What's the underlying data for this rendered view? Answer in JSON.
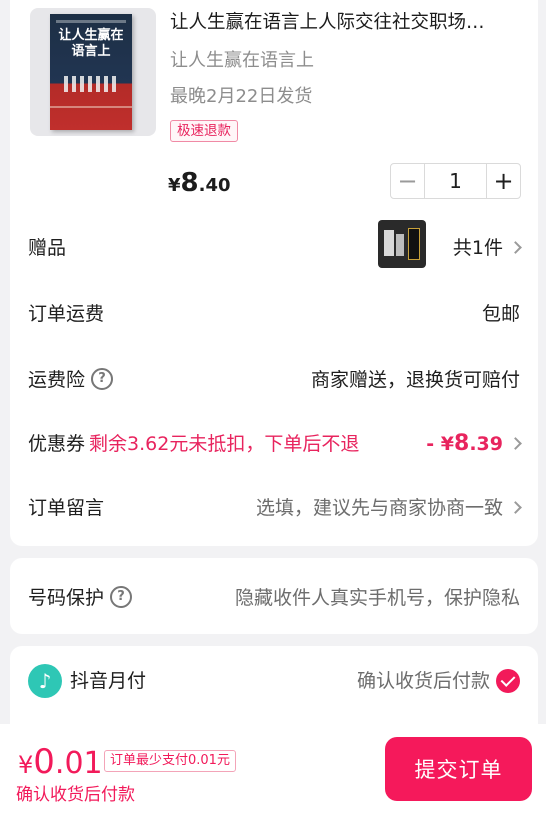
{
  "product": {
    "book_cover_title": "让人生赢在语言上",
    "title": "让人生赢在语言上人际交往社交职场…",
    "subtitle": "让人生赢在语言上",
    "shipping_note": "最晚2月22日发货",
    "tag": "极速退款",
    "price_currency": "¥",
    "price_integer": "8",
    "price_decimal": ".40",
    "quantity": "1",
    "minus_symbol": "−",
    "plus_symbol": "+"
  },
  "rows": {
    "gift": {
      "label": "赠品",
      "value": "共1件"
    },
    "shipping_fee": {
      "label": "订单运费",
      "value": "包邮"
    },
    "shipping_insurance": {
      "label": "运费险",
      "help": "?",
      "value": "商家赠送，退换货可赔付"
    },
    "coupon": {
      "label": "优惠券",
      "note": "剩余3.62元未抵扣，下单后不退",
      "discount_prefix": "- ¥",
      "discount_integer": "8",
      "discount_decimal": ".39"
    },
    "remark": {
      "label": "订单留言",
      "placeholder": "选填，建议先与商家协商一致"
    }
  },
  "privacy": {
    "label": "号码保护",
    "help": "?",
    "value": "隐藏收件人真实手机号，保护隐私"
  },
  "payment": {
    "icon": "♪",
    "label": "抖音月付",
    "value": "确认收货后付款"
  },
  "bottom_bar": {
    "currency": "¥",
    "total_integer": "0",
    "total_decimal": ".01",
    "min_pay_note": "订单最少支付0.01元",
    "pay_after": "确认收货后付款",
    "submit_label": "提交订单"
  },
  "colors": {
    "accent": "#f21a5a",
    "tiktok_pay": "#2ec7b5",
    "background": "#f2f2f4"
  }
}
